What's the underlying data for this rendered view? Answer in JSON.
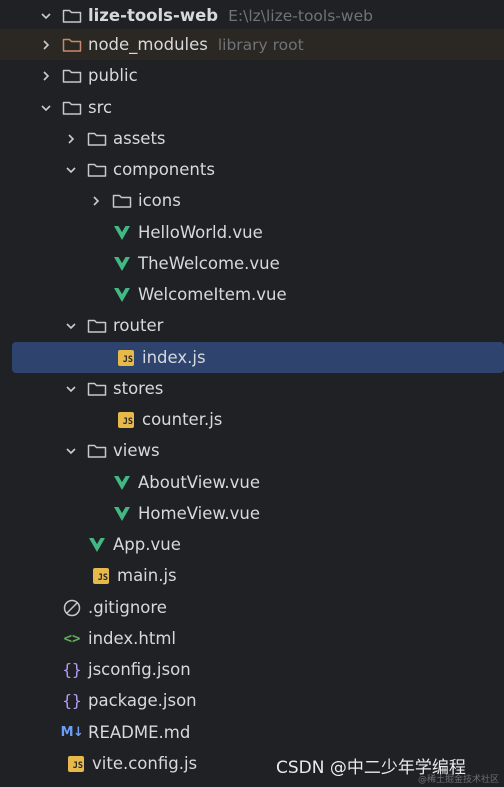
{
  "project": {
    "name": "lize-tools-web",
    "path": "E:\\lz\\lize-tools-web"
  },
  "tree": [
    {
      "key": "root",
      "label": "lize-tools-web",
      "hint": "E:\\lz\\lize-tools-web",
      "icon": "folder",
      "chevron": "down"
    },
    {
      "key": "node_modules",
      "label": "node_modules",
      "hint": "library root",
      "icon": "folder",
      "chevron": "right"
    },
    {
      "key": "public",
      "label": "public",
      "icon": "folder",
      "chevron": "right"
    },
    {
      "key": "src",
      "label": "src",
      "icon": "folder",
      "chevron": "down"
    },
    {
      "key": "assets",
      "label": "assets",
      "icon": "folder",
      "chevron": "right"
    },
    {
      "key": "components",
      "label": "components",
      "icon": "folder",
      "chevron": "down"
    },
    {
      "key": "icons",
      "label": "icons",
      "icon": "folder",
      "chevron": "right"
    },
    {
      "key": "helloworld",
      "label": "HelloWorld.vue",
      "icon": "vue"
    },
    {
      "key": "thewelcome",
      "label": "TheWelcome.vue",
      "icon": "vue"
    },
    {
      "key": "welcomeitem",
      "label": "WelcomeItem.vue",
      "icon": "vue"
    },
    {
      "key": "router",
      "label": "router",
      "icon": "folder",
      "chevron": "down"
    },
    {
      "key": "router_index",
      "label": "index.js",
      "icon": "js"
    },
    {
      "key": "stores",
      "label": "stores",
      "icon": "folder",
      "chevron": "down"
    },
    {
      "key": "counter",
      "label": "counter.js",
      "icon": "js"
    },
    {
      "key": "views",
      "label": "views",
      "icon": "folder",
      "chevron": "down"
    },
    {
      "key": "aboutview",
      "label": "AboutView.vue",
      "icon": "vue"
    },
    {
      "key": "homeview",
      "label": "HomeView.vue",
      "icon": "vue"
    },
    {
      "key": "app",
      "label": "App.vue",
      "icon": "vue"
    },
    {
      "key": "main",
      "label": "main.js",
      "icon": "js"
    },
    {
      "key": "gitignore",
      "label": ".gitignore",
      "icon": "ignore"
    },
    {
      "key": "index_html",
      "label": "index.html",
      "icon": "html"
    },
    {
      "key": "jsconfig",
      "label": "jsconfig.json",
      "icon": "json"
    },
    {
      "key": "package",
      "label": "package.json",
      "icon": "json"
    },
    {
      "key": "readme",
      "label": "README.md",
      "icon": "markdown"
    },
    {
      "key": "vite",
      "label": "vite.config.js",
      "icon": "js"
    }
  ],
  "selected": "router_index",
  "icon_glyphs": {
    "js": "JS",
    "markdown": "M↓",
    "html": "<>",
    "json": "{}"
  },
  "watermark": {
    "main": "CSDN @中二少年学编程",
    "small": "@稀土掘金技术社区"
  },
  "colors": {
    "background": "#1f2125",
    "selection": "#2e436e",
    "excluded": "#2b2722",
    "folder": "#c5c8ce",
    "excluded_folder": "#c98a6c",
    "vue": "#42b883",
    "js": "#e7b94b",
    "json": "#b59df3",
    "html": "#5fb057",
    "markdown": "#6b9ef5"
  }
}
